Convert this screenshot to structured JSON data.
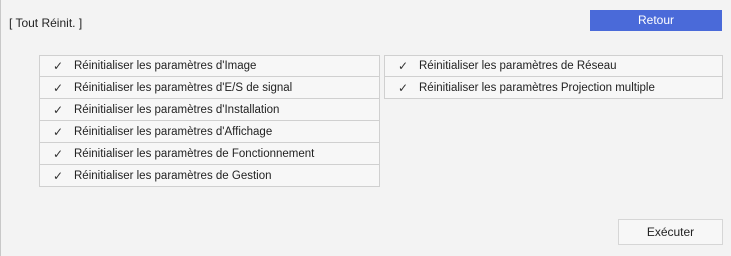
{
  "header": {
    "title": "[ Tout Réinit. ]",
    "back_label": "Retour"
  },
  "left_items": [
    {
      "label": "Réinitialiser les paramètres d'Image",
      "checked": true
    },
    {
      "label": "Réinitialiser les paramètres d'E/S de signal",
      "checked": true
    },
    {
      "label": "Réinitialiser les paramètres d'Installation",
      "checked": true
    },
    {
      "label": "Réinitialiser les paramètres d'Affichage",
      "checked": true
    },
    {
      "label": "Réinitialiser les paramètres de Fonctionnement",
      "checked": true
    },
    {
      "label": "Réinitialiser les paramètres de Gestion",
      "checked": true
    }
  ],
  "right_items": [
    {
      "label": "Réinitialiser les paramètres de Réseau",
      "checked": true
    },
    {
      "label": "Réinitialiser les paramètres Projection multiple",
      "checked": true
    }
  ],
  "check_glyph": "✓",
  "footer": {
    "execute_label": "Exécuter"
  },
  "colors": {
    "accent": "#4a6ad9",
    "background": "#f3f3f3"
  }
}
